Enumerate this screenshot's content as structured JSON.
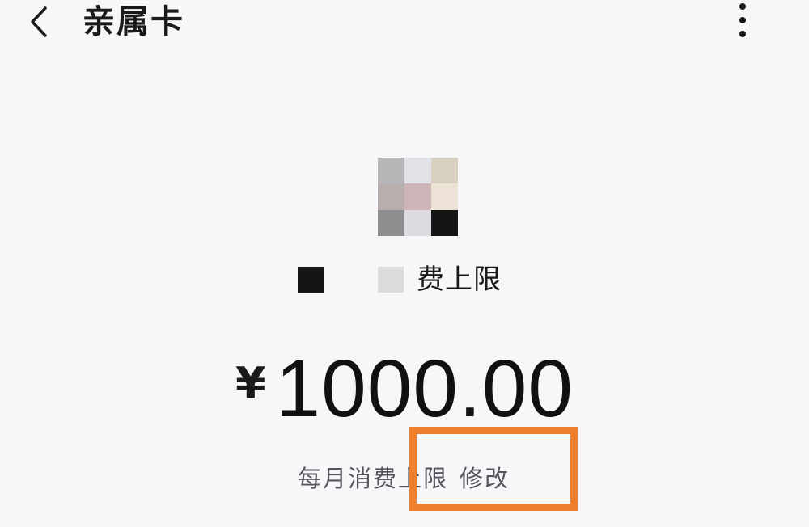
{
  "header": {
    "title": "亲属卡",
    "back_icon": "chevron-left-icon",
    "more_icon": "more-vertical-icon"
  },
  "profile": {
    "avatar_icon": "pixelated-avatar",
    "avatar_colors": [
      "#b8b6b9",
      "#e2e3e8",
      "#d8d0c0",
      "#b9aeae",
      "#cdb4b7",
      "#ede2d6",
      "#8e8d90",
      "#dcdce0",
      "#151515"
    ]
  },
  "limit": {
    "label": "费上限",
    "currency": "¥",
    "amount": "1000.00"
  },
  "footer": {
    "monthly_label": "每月消费上限",
    "edit_label": "修改"
  },
  "colors": {
    "highlight": "#ee7f2d",
    "background": "#f7f7f9"
  }
}
